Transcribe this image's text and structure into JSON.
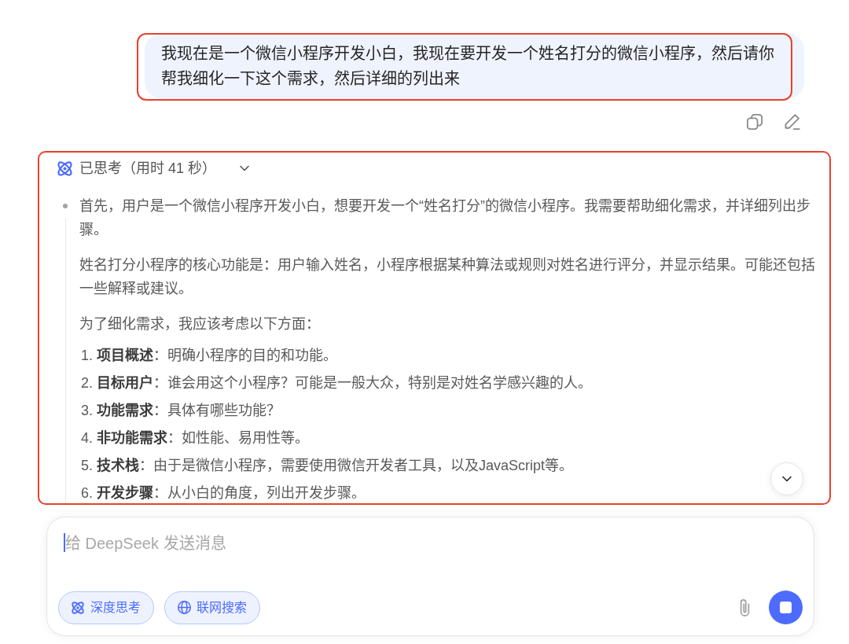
{
  "user_message": {
    "text": "我现在是一个微信小程序开发小白，我现在要开发一个姓名打分的微信小程序，然后请你帮我细化一下这个需求，然后详细的列出来",
    "highlighted": true
  },
  "thinking": {
    "title": "已思考（用时 41 秒）",
    "expanded": true,
    "highlighted": true,
    "paragraphs": [
      "首先，用户是一个微信小程序开发小白，想要开发一个“姓名打分”的微信小程序。我需要帮助细化需求，并详细列出步骤。",
      "姓名打分小程序的核心功能是：用户输入姓名，小程序根据某种算法或规则对姓名进行评分，并显示结果。可能还包括一些解释或建议。",
      "为了细化需求，我应该考虑以下方面："
    ],
    "list": [
      "1. **项目概述**：明确小程序的目的和功能。",
      "2. **目标用户**：谁会用这个小程序？可能是一般大众，特别是对姓名学感兴趣的人。",
      "3. **功能需求**：具体有哪些功能？",
      "4. **非功能需求**：如性能、易用性等。",
      "5. **技术栈**：由于是微信小程序，需要使用微信开发者工具，以及JavaScript等。",
      "6. **开发步骤**：从小白的角度，列出开发步骤。"
    ]
  },
  "composer": {
    "placeholder": "给 DeepSeek 发送消息",
    "focused": true,
    "toggles": [
      {
        "kind": "deep-think",
        "label": "深度思考",
        "selected": true
      },
      {
        "kind": "web-search",
        "label": "联网搜索",
        "selected": true
      }
    ],
    "generating": true
  }
}
